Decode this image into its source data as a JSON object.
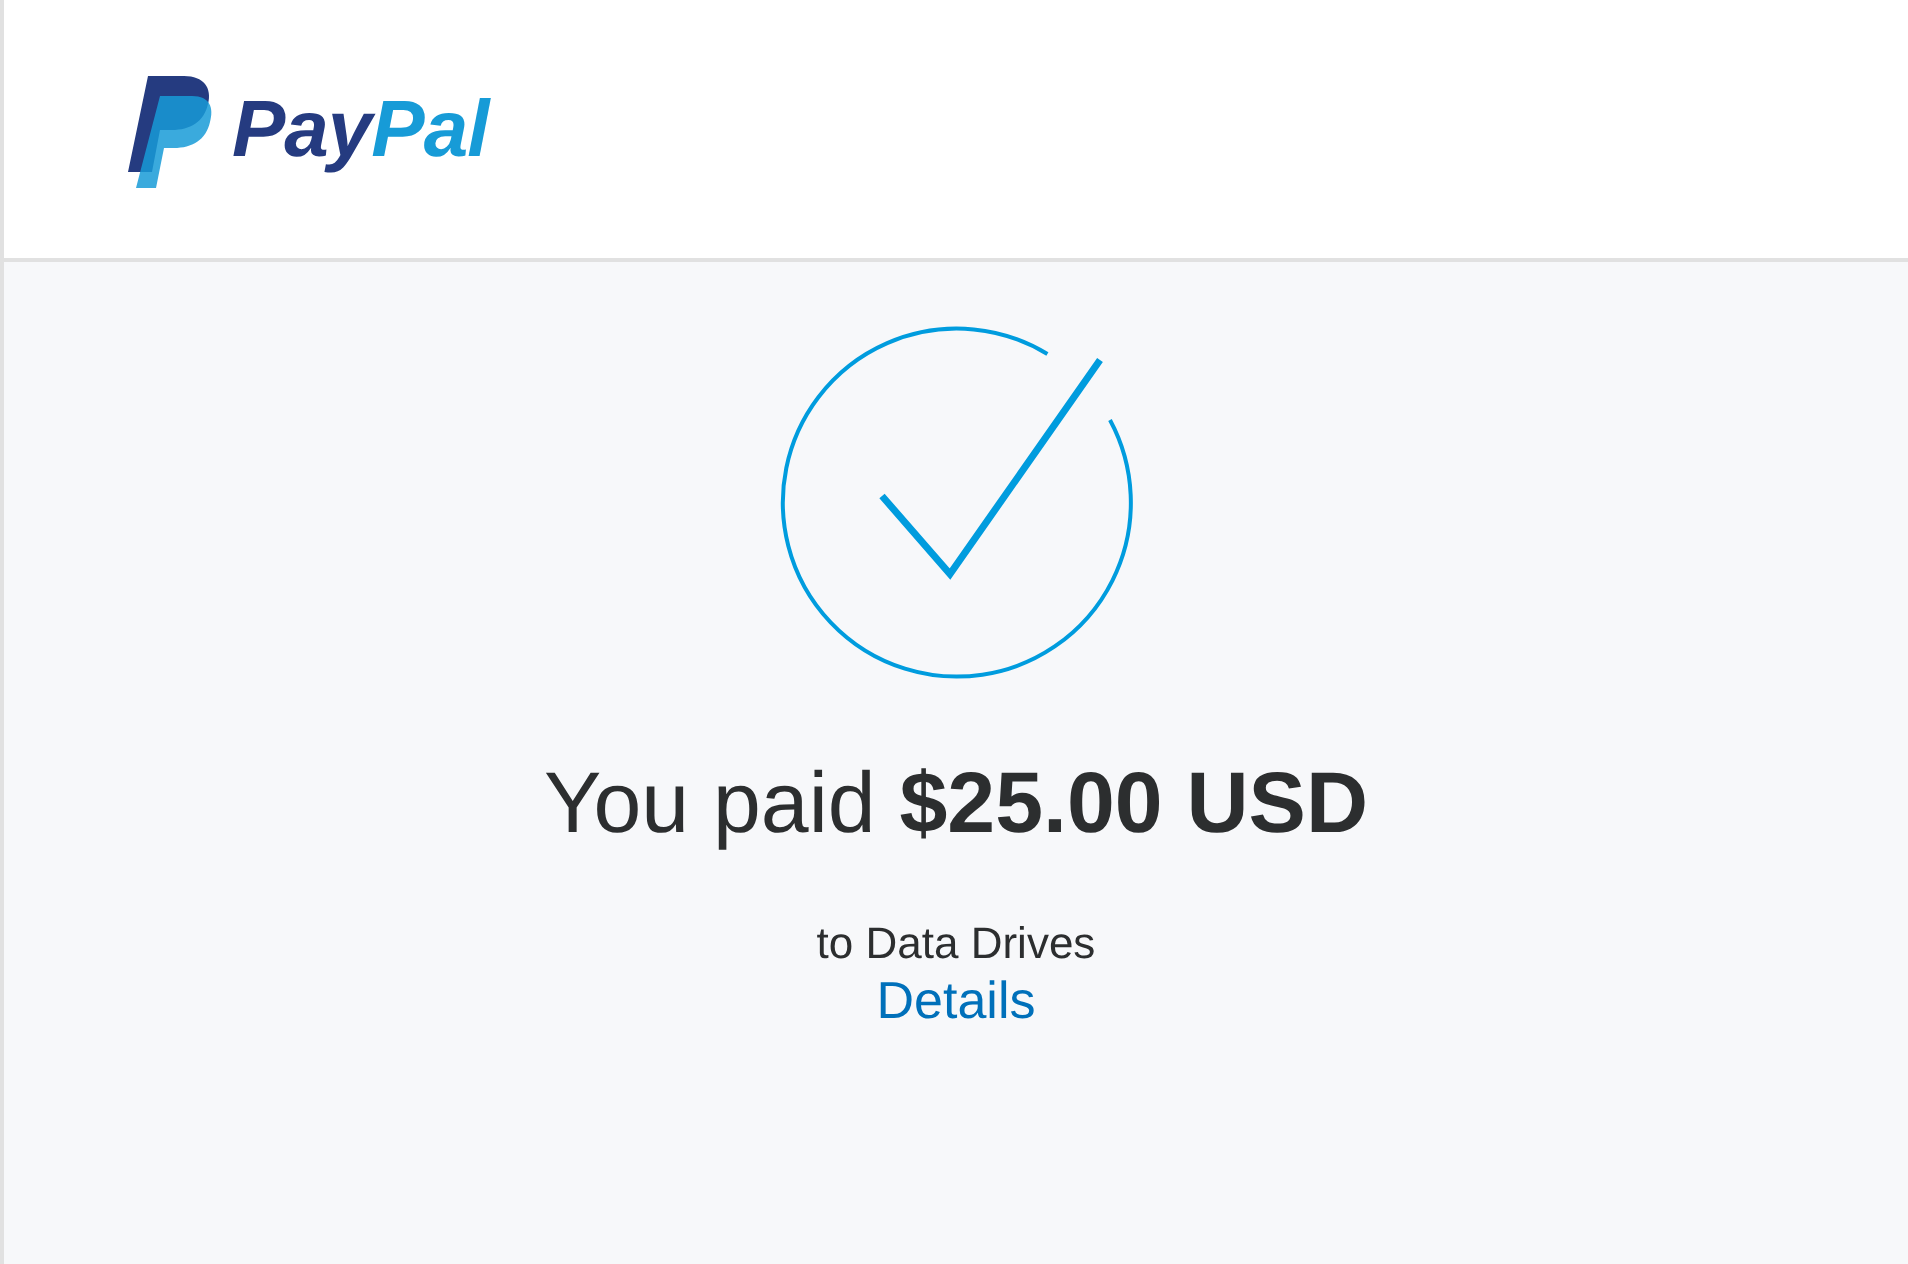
{
  "header": {
    "logo": {
      "word_dark": "Pay",
      "word_light": "Pal"
    }
  },
  "confirmation": {
    "heading": "You paid **$25.00 USD**",
    "recipient": "to Data Drives",
    "details_link": "Details"
  }
}
